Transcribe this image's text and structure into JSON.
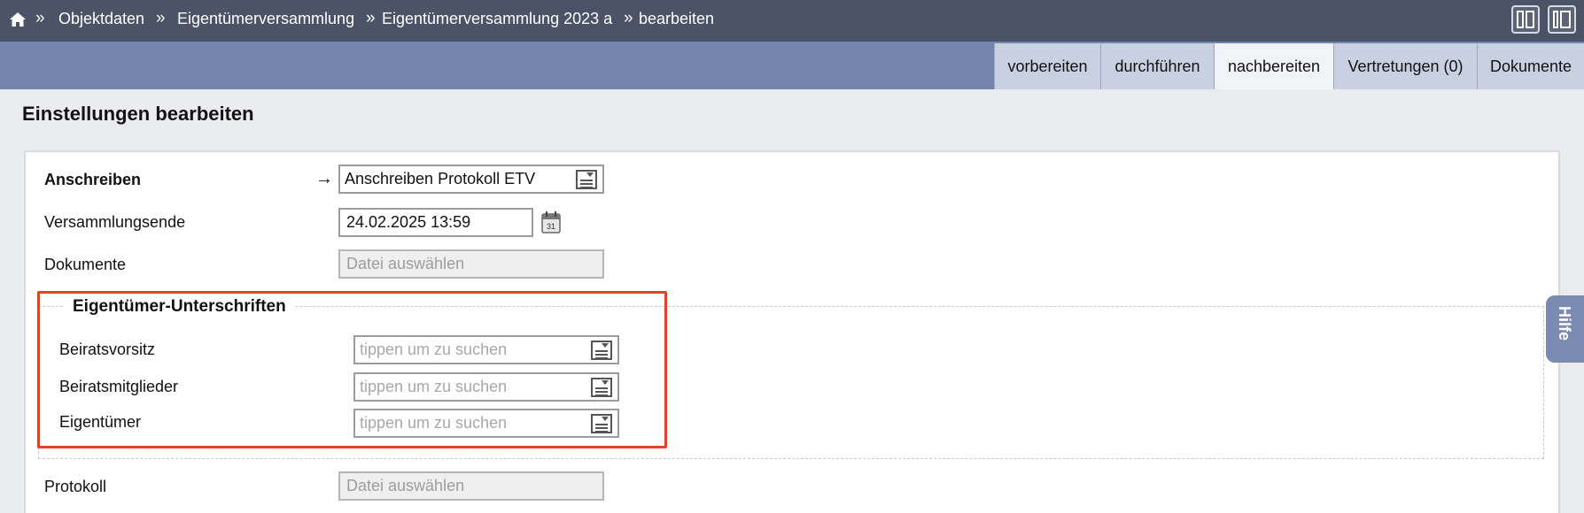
{
  "breadcrumb": {
    "separator": "»",
    "items": [
      "Objektdaten",
      "Eigentümerversammlung",
      "Eigentümerversammlung 2023 a",
      "bearbeiten"
    ]
  },
  "tabs": [
    {
      "label": "vorbereiten"
    },
    {
      "label": "durchführen"
    },
    {
      "label": "nachbereiten"
    },
    {
      "label": "Vertretungen (0)"
    },
    {
      "label": "Dokumente"
    }
  ],
  "active_tab": "nachbereiten",
  "page": {
    "title": "Einstellungen bearbeiten"
  },
  "form": {
    "anschreiben": {
      "label": "Anschreiben",
      "arrow": "→",
      "value": "Anschreiben Protokoll ETV"
    },
    "versammlungsende": {
      "label": "Versammlungsende",
      "value": "24.02.2025 13:59"
    },
    "dokumente": {
      "label": "Dokumente",
      "placeholder": "Datei auswählen"
    },
    "signatures": {
      "legend": "Eigentümer-Unterschriften",
      "fields": [
        {
          "label": "Beiratsvorsitz",
          "placeholder": "tippen um zu suchen"
        },
        {
          "label": "Beiratsmitglieder",
          "placeholder": "tippen um zu suchen"
        },
        {
          "label": "Eigentümer",
          "placeholder": "tippen um zu suchen"
        }
      ]
    },
    "protokoll": {
      "label": "Protokoll",
      "placeholder": "Datei auswählen"
    }
  },
  "help": {
    "label": "Hilfe"
  },
  "colors": {
    "topbar": "#4c5367",
    "tabbar": "#7385ad",
    "highlight": "#e0432c"
  },
  "icons": [
    "home-icon",
    "layout-two-column-icon",
    "layout-sidebar-icon",
    "select-list-icon",
    "calendar-icon"
  ]
}
